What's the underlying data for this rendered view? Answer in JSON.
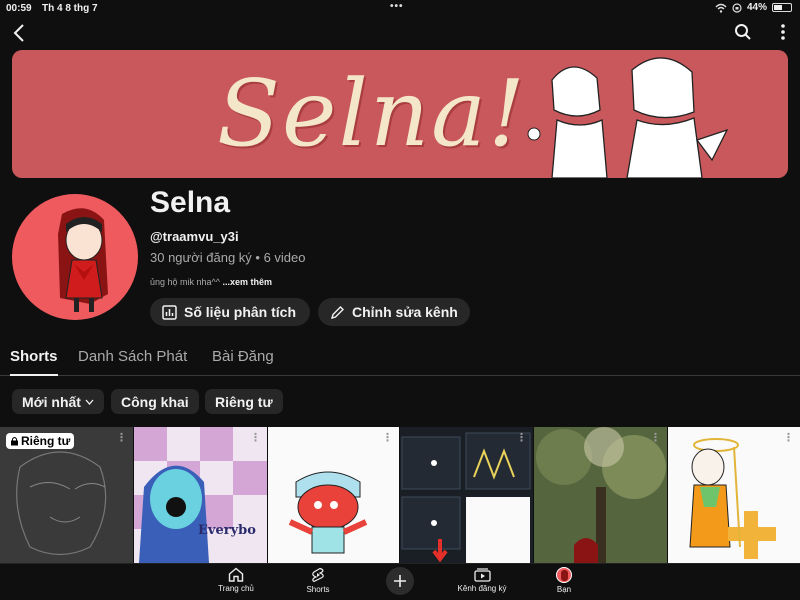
{
  "status_bar": {
    "time": "00:59",
    "date": "Th 4 8 thg 7",
    "battery": "44%",
    "battery_level": 0.44
  },
  "banner": {
    "text": "Selna!"
  },
  "channel": {
    "name": "Selna",
    "handle": "@traamvu_y3i",
    "meta": "30 người đăng ký • 6 video",
    "description": "ủng hộ mik nha^^",
    "more_link": "...xem thêm"
  },
  "actions": {
    "analytics": "Số liệu phân tích",
    "edit": "Chỉnh sửa kênh"
  },
  "tabs": [
    {
      "label": "Shorts",
      "active": true
    },
    {
      "label": "Danh Sách Phát",
      "active": false
    },
    {
      "label": "Bài Đăng",
      "active": false
    }
  ],
  "chips": {
    "newest": "Mới nhất",
    "public": "Công khai",
    "private": "Riêng tư"
  },
  "grid": {
    "private_badge": "Riêng tư",
    "thumb2_text": "Everybo"
  },
  "bottom_nav": {
    "home": "Trang chủ",
    "shorts": "Shorts",
    "subscriptions": "Kênh đăng ký",
    "you": "Bạn"
  },
  "colors": {
    "background": "#0f0f0f",
    "banner": "#c9585c",
    "avatar_bg": "#ef5a5e",
    "chip_bg": "#272727"
  }
}
